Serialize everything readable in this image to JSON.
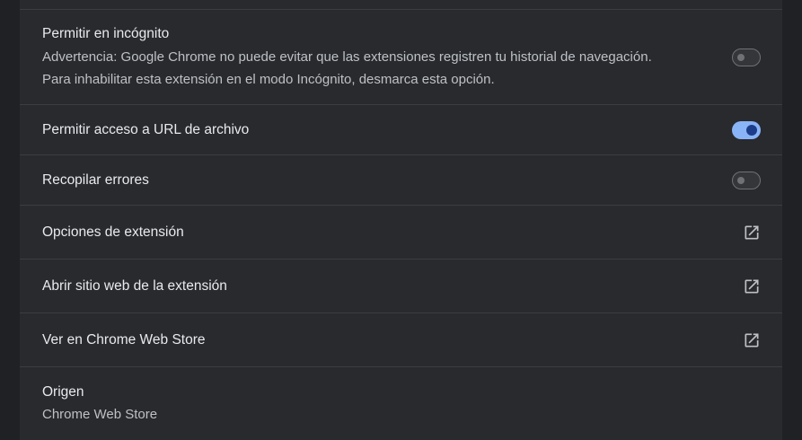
{
  "settings": {
    "incognito": {
      "label": "Permitir en incógnito",
      "warning_line1": "Advertencia: Google Chrome no puede evitar que las extensiones registren tu historial de navegación.",
      "warning_line2": "Para inhabilitar esta extensión en el modo Incógnito, desmarca esta opción.",
      "enabled": false
    },
    "file_url_access": {
      "label": "Permitir acceso a URL de archivo",
      "enabled": true
    },
    "collect_errors": {
      "label": "Recopilar errores",
      "enabled": false
    },
    "extension_options": {
      "label": "Opciones de extensión",
      "icon": "open-in-new-icon"
    },
    "open_website": {
      "label": "Abrir sitio web de la extensión",
      "icon": "open-in-new-icon"
    },
    "view_store": {
      "label": "Ver en Chrome Web Store",
      "icon": "open-in-new-icon"
    },
    "source": {
      "label": "Origen",
      "value": "Chrome Web Store"
    }
  },
  "colors": {
    "background": "#202124",
    "card": "#292a2d",
    "divider": "#3c3d41",
    "text_primary": "#e8eaed",
    "text_secondary": "#bdc1c6",
    "toggle_on_track": "#8ab4f8",
    "toggle_on_knob": "#1c3e8a"
  }
}
